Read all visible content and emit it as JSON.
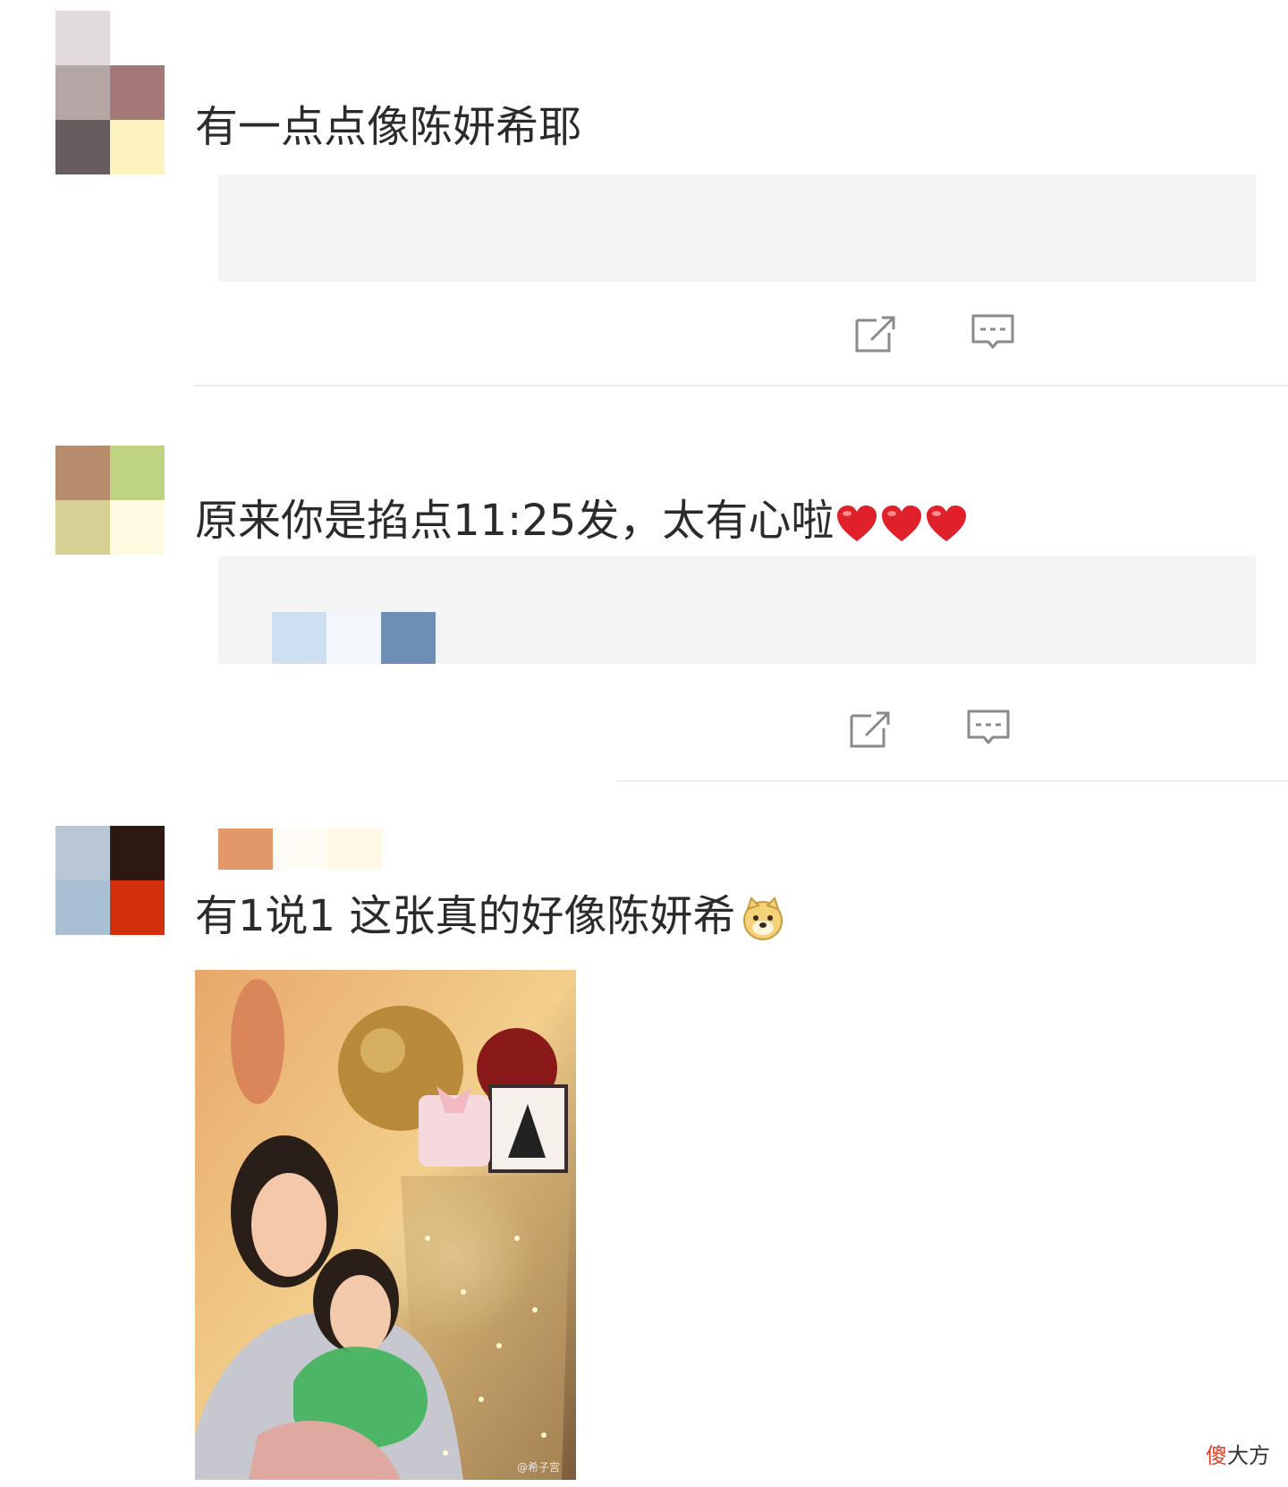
{
  "comments": [
    {
      "text": "有一点点像陈妍希耶",
      "avatar_colors": [
        "#e2dbdd",
        "#ffffff",
        "#b5a7a6",
        "#a37876",
        "#675c5d",
        "#fdf3be"
      ]
    },
    {
      "text": "原来你是掐点11:25发，太有心啦",
      "emoji": [
        "red-heart",
        "red-heart",
        "red-heart"
      ],
      "avatar_colors": [
        "#b88d6d",
        "#bed483",
        "#d7d094",
        "#fffbe3"
      ],
      "reply_colors": [
        "#cddff0",
        "#f3f7fc",
        "#6e8fb5"
      ]
    },
    {
      "text": "有1说1 这张真的好像陈妍希",
      "emoji": [
        "doge"
      ],
      "avatar_colors": [
        "#b8c6d5",
        "#2d1812",
        "#a9c0d3",
        "#d2300c"
      ],
      "name_colors": [
        "#e3986a",
        "#fffcf6",
        "#fff8e6"
      ],
      "image_alt": "photo of woman and child with balloons and cake",
      "image_watermark": "@希子宫"
    }
  ],
  "actions": {
    "share_icon": "share-icon",
    "reply_icon": "comment-icon"
  },
  "watermark": {
    "part1": "傻",
    "part2": "大方"
  }
}
